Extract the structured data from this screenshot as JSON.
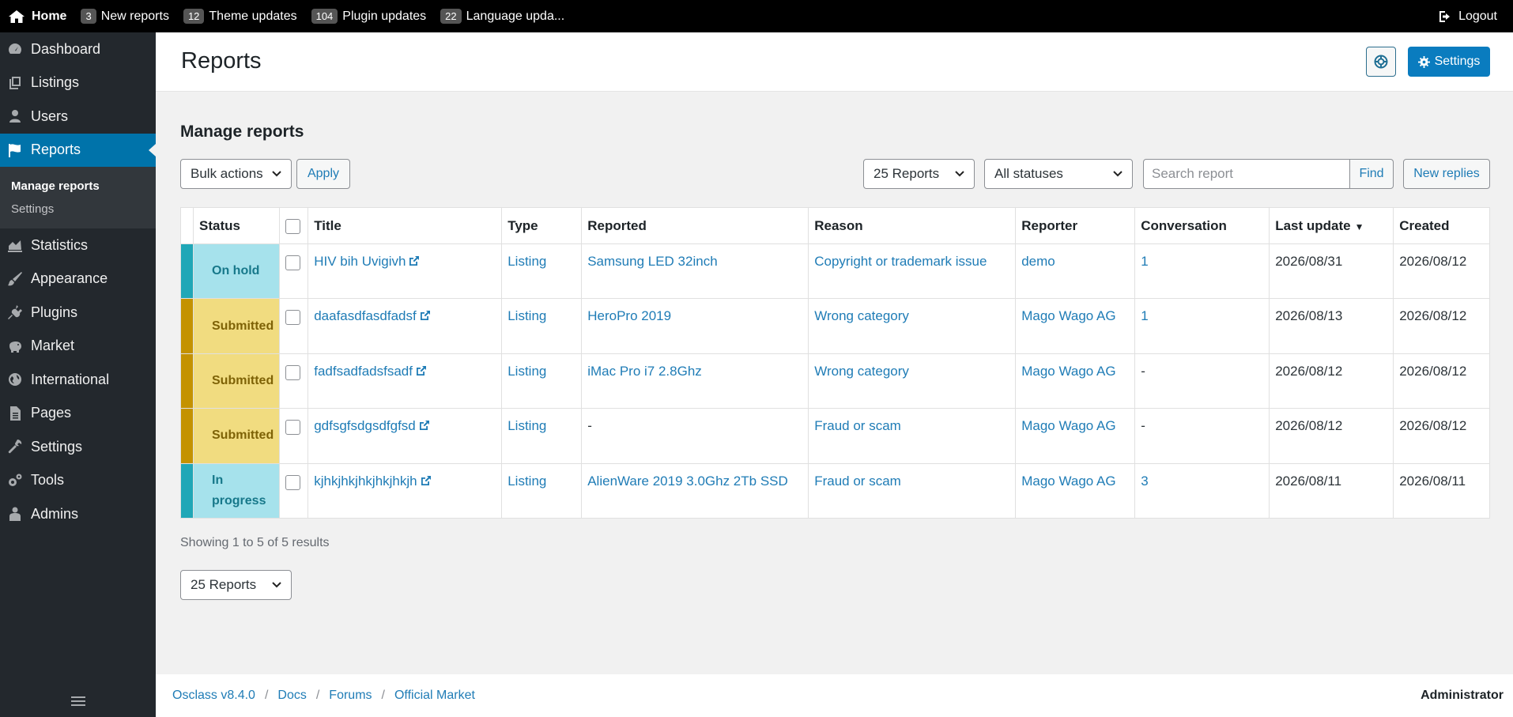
{
  "topbar": {
    "home": "Home",
    "items": [
      {
        "count": "3",
        "label": "New reports"
      },
      {
        "count": "12",
        "label": "Theme updates"
      },
      {
        "count": "104",
        "label": "Plugin updates"
      },
      {
        "count": "22",
        "label": "Language upda..."
      }
    ],
    "logout": "Logout"
  },
  "sidebar": {
    "items": [
      {
        "label": "Dashboard",
        "icon": "dashboard-icon"
      },
      {
        "label": "Listings",
        "icon": "listings-icon"
      },
      {
        "label": "Users",
        "icon": "users-icon"
      },
      {
        "label": "Reports",
        "icon": "flag-icon",
        "active": true
      },
      {
        "label": "Statistics",
        "icon": "statistics-icon"
      },
      {
        "label": "Appearance",
        "icon": "brush-icon"
      },
      {
        "label": "Plugins",
        "icon": "plug-icon"
      },
      {
        "label": "Market",
        "icon": "piggy-icon"
      },
      {
        "label": "International",
        "icon": "globe-icon"
      },
      {
        "label": "Pages",
        "icon": "pages-icon"
      },
      {
        "label": "Settings",
        "icon": "wrench-icon"
      },
      {
        "label": "Tools",
        "icon": "gears-icon"
      },
      {
        "label": "Admins",
        "icon": "admins-icon"
      }
    ],
    "submenu": [
      "Manage reports",
      "Settings"
    ]
  },
  "header": {
    "title": "Reports",
    "settings_label": "Settings"
  },
  "main": {
    "section_title": "Manage reports",
    "bulk_actions": "Bulk actions",
    "apply": "Apply",
    "per_page": "25 Reports",
    "status_filter": "All statuses",
    "search_placeholder": "Search report",
    "find": "Find",
    "new_replies": "New replies",
    "showing": "Showing 1 to 5 of 5 results",
    "per_page_bottom": "25 Reports"
  },
  "table": {
    "columns": [
      "Status",
      "Title",
      "Type",
      "Reported",
      "Reason",
      "Reporter",
      "Conversation",
      "Last update",
      "Created"
    ],
    "rows": [
      {
        "status": "On hold",
        "stripe": "#20a7b7",
        "bg": "#a6e2ec",
        "fg": "#17788a",
        "title": "HIV bih Uvigivh",
        "type": "Listing",
        "reported": "Samsung LED 32inch",
        "reason": "Copyright or trademark issue",
        "reporter": "demo",
        "conversation": "1",
        "last_update": "2026/08/31",
        "created": "2026/08/12"
      },
      {
        "status": "Submitted",
        "stripe": "#c49200",
        "bg": "#f1dc80",
        "fg": "#7e6206",
        "title": "daafasdfasdfadsf",
        "type": "Listing",
        "reported": "HeroPro 2019",
        "reason": "Wrong category",
        "reporter": "Mago Wago AG",
        "conversation": "1",
        "last_update": "2026/08/13",
        "created": "2026/08/12"
      },
      {
        "status": "Submitted",
        "stripe": "#c49200",
        "bg": "#f1dc80",
        "fg": "#7e6206",
        "title": "fadfsadfadsfsadf",
        "type": "Listing",
        "reported": "iMac Pro i7 2.8Ghz",
        "reason": "Wrong category",
        "reporter": "Mago Wago AG",
        "conversation": "-",
        "last_update": "2026/08/12",
        "created": "2026/08/12"
      },
      {
        "status": "Submitted",
        "stripe": "#c49200",
        "bg": "#f1dc80",
        "fg": "#7e6206",
        "title": "gdfsgfsdgsdfgfsd",
        "type": "Listing",
        "reported": "-",
        "reason": "Fraud or scam",
        "reporter": "Mago Wago AG",
        "conversation": "-",
        "last_update": "2026/08/12",
        "created": "2026/08/12"
      },
      {
        "status": "In progress",
        "stripe": "#20a7b7",
        "bg": "#a6e2ec",
        "fg": "#17788a",
        "title": "kjhkjhkjhkjhkjhkjh",
        "type": "Listing",
        "reported": "AlienWare 2019 3.0Ghz 2Tb SSD",
        "reason": "Fraud or scam",
        "reporter": "Mago Wago AG",
        "conversation": "3",
        "last_update": "2026/08/11",
        "created": "2026/08/11"
      }
    ]
  },
  "footer": {
    "links": [
      "Osclass v8.4.0",
      "Docs",
      "Forums",
      "Official Market"
    ],
    "user": "Administrator"
  }
}
